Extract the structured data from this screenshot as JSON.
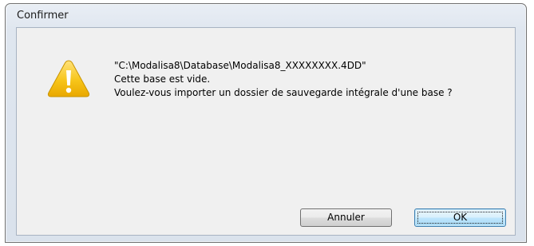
{
  "window": {
    "title": "Confirmer"
  },
  "dialog": {
    "icon": "warning-icon",
    "icon_color": "#f5c30f",
    "lines": [
      "\"C:\\Modalisa8\\Database\\Modalisa8_XXXXXXXX.4DD\"",
      "Cette base est vide.",
      "Voulez-vous importer un dossier de sauvegarde intégrale d'une base ?"
    ]
  },
  "buttons": {
    "cancel_label": "Annuler",
    "ok_label": "OK"
  }
}
